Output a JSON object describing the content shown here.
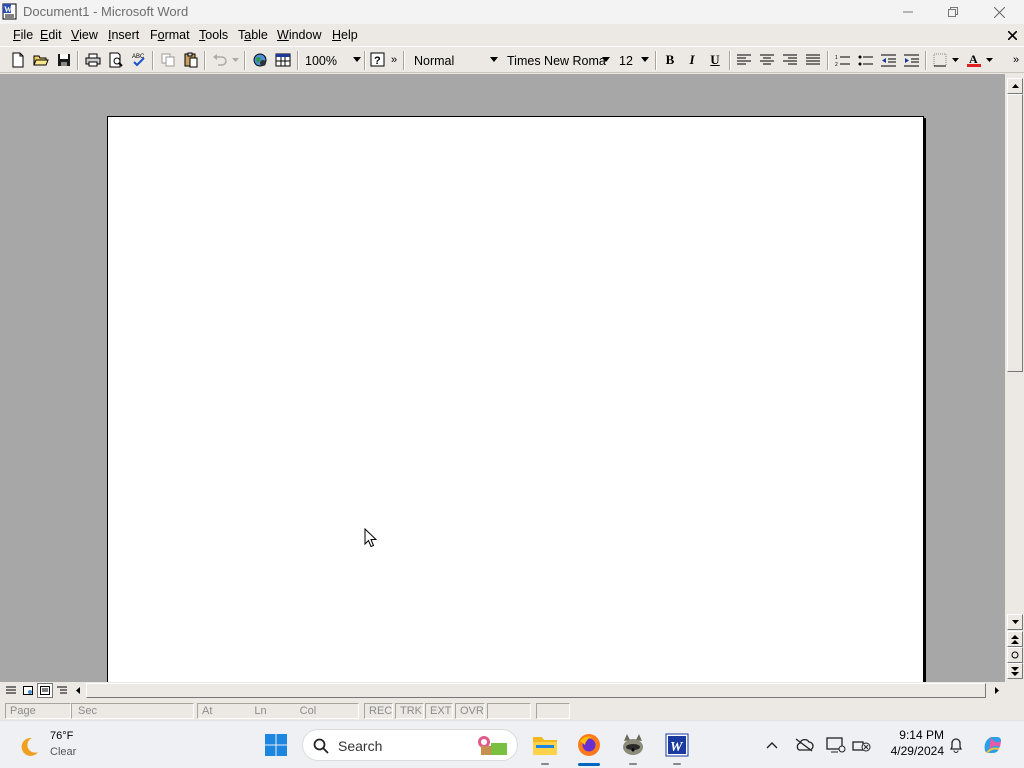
{
  "window": {
    "title": "Document1 - Microsoft Word",
    "app_icon": "word-doc-icon"
  },
  "menus": [
    {
      "pre": "",
      "ul": "F",
      "post": "ile"
    },
    {
      "pre": "",
      "ul": "E",
      "post": "dit"
    },
    {
      "pre": "",
      "ul": "V",
      "post": "iew"
    },
    {
      "pre": "",
      "ul": "I",
      "post": "nsert"
    },
    {
      "pre": "F",
      "ul": "o",
      "post": "rmat"
    },
    {
      "pre": "",
      "ul": "T",
      "post": "ools"
    },
    {
      "pre": "T",
      "ul": "a",
      "post": "ble"
    },
    {
      "pre": "",
      "ul": "W",
      "post": "indow"
    },
    {
      "pre": "",
      "ul": "H",
      "post": "elp"
    }
  ],
  "toolbar": {
    "zoom": "100%",
    "style": "Normal",
    "font": "Times New Roma",
    "size": "12",
    "bold": "B",
    "italic": "I",
    "underline": "U",
    "more": "»",
    "help": "?"
  },
  "status": {
    "page": "Page",
    "sec": "Sec",
    "at": "At",
    "ln": "Ln",
    "col": "Col",
    "rec": "REC",
    "trk": "TRK",
    "ext": "EXT",
    "ovr": "OVR"
  },
  "weather": {
    "temp": "76°F",
    "cond": "Clear"
  },
  "search": {
    "label": "Search"
  },
  "clock": {
    "time": "9:14 PM",
    "date": "4/29/2024"
  },
  "colors": {
    "font_color": "#e02020",
    "accent": "#0067c0"
  }
}
